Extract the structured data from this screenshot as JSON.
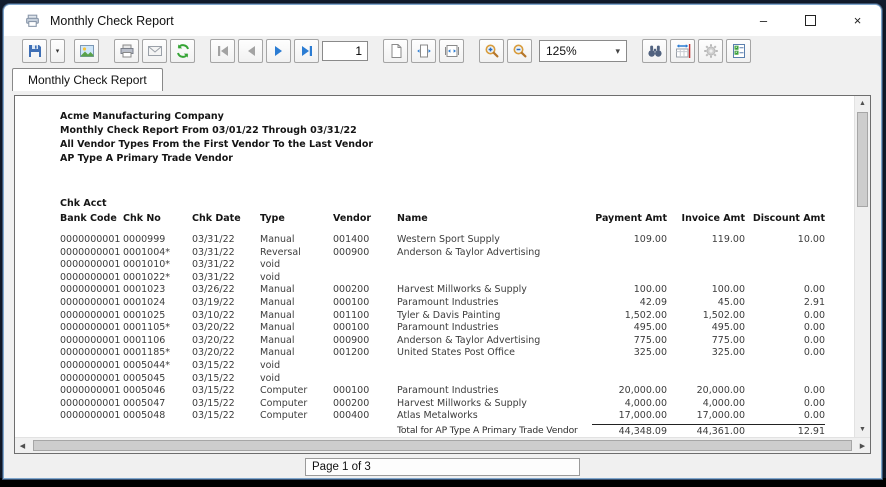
{
  "window": {
    "title": "Monthly Check Report",
    "controls": {
      "minimize": "–",
      "close": "×"
    },
    "title_icon": "printer-report-icon"
  },
  "toolbar": {
    "page_number": "1",
    "zoom_level": "125%",
    "dropdown_glyph": "▾",
    "icons": [
      "save-icon",
      "save-dropdown-icon",
      "export-image-icon",
      "print-icon",
      "email-icon",
      "refresh-icon",
      "first-page-icon",
      "previous-page-icon",
      "next-page-icon",
      "last-page-icon",
      "actual-size-icon",
      "fit-page-icon",
      "fit-width-icon",
      "zoom-in-icon",
      "zoom-out-icon",
      "find-icon",
      "column-width-icon",
      "settings-gear-icon",
      "report-options-icon"
    ]
  },
  "tabs": [
    {
      "label": "Monthly Check Report"
    }
  ],
  "scrollbar": {
    "up": "▲",
    "down": "▼",
    "left": "◀",
    "right": "▶"
  },
  "report": {
    "header_lines": [
      "Acme Manufacturing Company",
      "Monthly Check Report From 03/01/22 Through 03/31/22",
      "All Vendor Types From the First Vendor To the Last Vendor",
      "AP Type A  Primary Trade Vendor"
    ],
    "columns": {
      "acct_line": "Chk Acct",
      "headers": [
        "Bank Code",
        "Chk No",
        "Chk Date",
        "Type",
        "Vendor",
        "Name",
        "Payment Amt",
        "Invoice Amt",
        "Discount Amt"
      ]
    },
    "rows": [
      {
        "bank": "0000000001",
        "chk_no": "0000999",
        "chk_date": "03/31/22",
        "type": "Manual",
        "vendor": "001400",
        "name": "Western Sport Supply",
        "payment": "109.00",
        "invoice": "119.00",
        "discount": "10.00"
      },
      {
        "bank": "0000000001",
        "chk_no": "0001004*",
        "chk_date": "03/31/22",
        "type": "Reversal",
        "vendor": "000900",
        "name": "Anderson & Taylor Advertising",
        "payment": "",
        "invoice": "",
        "discount": ""
      },
      {
        "bank": "0000000001",
        "chk_no": "0001010*",
        "chk_date": "03/31/22",
        "type": "void",
        "vendor": "",
        "name": "",
        "payment": "",
        "invoice": "",
        "discount": ""
      },
      {
        "bank": "0000000001",
        "chk_no": "0001022*",
        "chk_date": "03/31/22",
        "type": "void",
        "vendor": "",
        "name": "",
        "payment": "",
        "invoice": "",
        "discount": ""
      },
      {
        "bank": "0000000001",
        "chk_no": "0001023",
        "chk_date": "03/26/22",
        "type": "Manual",
        "vendor": "000200",
        "name": "Harvest Millworks & Supply",
        "payment": "100.00",
        "invoice": "100.00",
        "discount": "0.00"
      },
      {
        "bank": "0000000001",
        "chk_no": "0001024",
        "chk_date": "03/19/22",
        "type": "Manual",
        "vendor": "000100",
        "name": "Paramount Industries",
        "payment": "42.09",
        "invoice": "45.00",
        "discount": "2.91"
      },
      {
        "bank": "0000000001",
        "chk_no": "0001025",
        "chk_date": "03/10/22",
        "type": "Manual",
        "vendor": "001100",
        "name": "Tyler & Davis Painting",
        "payment": "1,502.00",
        "invoice": "1,502.00",
        "discount": "0.00"
      },
      {
        "bank": "0000000001",
        "chk_no": "0001105*",
        "chk_date": "03/20/22",
        "type": "Manual",
        "vendor": "000100",
        "name": "Paramount Industries",
        "payment": "495.00",
        "invoice": "495.00",
        "discount": "0.00"
      },
      {
        "bank": "0000000001",
        "chk_no": "0001106",
        "chk_date": "03/20/22",
        "type": "Manual",
        "vendor": "000900",
        "name": "Anderson & Taylor Advertising",
        "payment": "775.00",
        "invoice": "775.00",
        "discount": "0.00"
      },
      {
        "bank": "0000000001",
        "chk_no": "0001185*",
        "chk_date": "03/20/22",
        "type": "Manual",
        "vendor": "001200",
        "name": "United States Post Office",
        "payment": "325.00",
        "invoice": "325.00",
        "discount": "0.00"
      },
      {
        "bank": "0000000001",
        "chk_no": "0005044*",
        "chk_date": "03/15/22",
        "type": "void",
        "vendor": "",
        "name": "",
        "payment": "",
        "invoice": "",
        "discount": ""
      },
      {
        "bank": "0000000001",
        "chk_no": "0005045",
        "chk_date": "03/15/22",
        "type": "void",
        "vendor": "",
        "name": "",
        "payment": "",
        "invoice": "",
        "discount": ""
      },
      {
        "bank": "0000000001",
        "chk_no": "0005046",
        "chk_date": "03/15/22",
        "type": "Computer",
        "vendor": "000100",
        "name": "Paramount Industries",
        "payment": "20,000.00",
        "invoice": "20,000.00",
        "discount": "0.00"
      },
      {
        "bank": "0000000001",
        "chk_no": "0005047",
        "chk_date": "03/15/22",
        "type": "Computer",
        "vendor": "000200",
        "name": "Harvest Millworks & Supply",
        "payment": "4,000.00",
        "invoice": "4,000.00",
        "discount": "0.00"
      },
      {
        "bank": "0000000001",
        "chk_no": "0005048",
        "chk_date": "03/15/22",
        "type": "Computer",
        "vendor": "000400",
        "name": "Atlas Metalworks",
        "payment": "17,000.00",
        "invoice": "17,000.00",
        "discount": "0.00"
      }
    ],
    "total": {
      "label": "Total for AP Type A  Primary Trade Vendor",
      "payment": "44,348.09",
      "invoice": "44,361.00",
      "discount": "12.91"
    }
  },
  "statusbar": {
    "page_info": "Page 1 of 3"
  },
  "colors": {
    "accent_blue": "#2b7cd3",
    "refresh_green": "#35a435",
    "window_border": "#7fa6cc"
  }
}
